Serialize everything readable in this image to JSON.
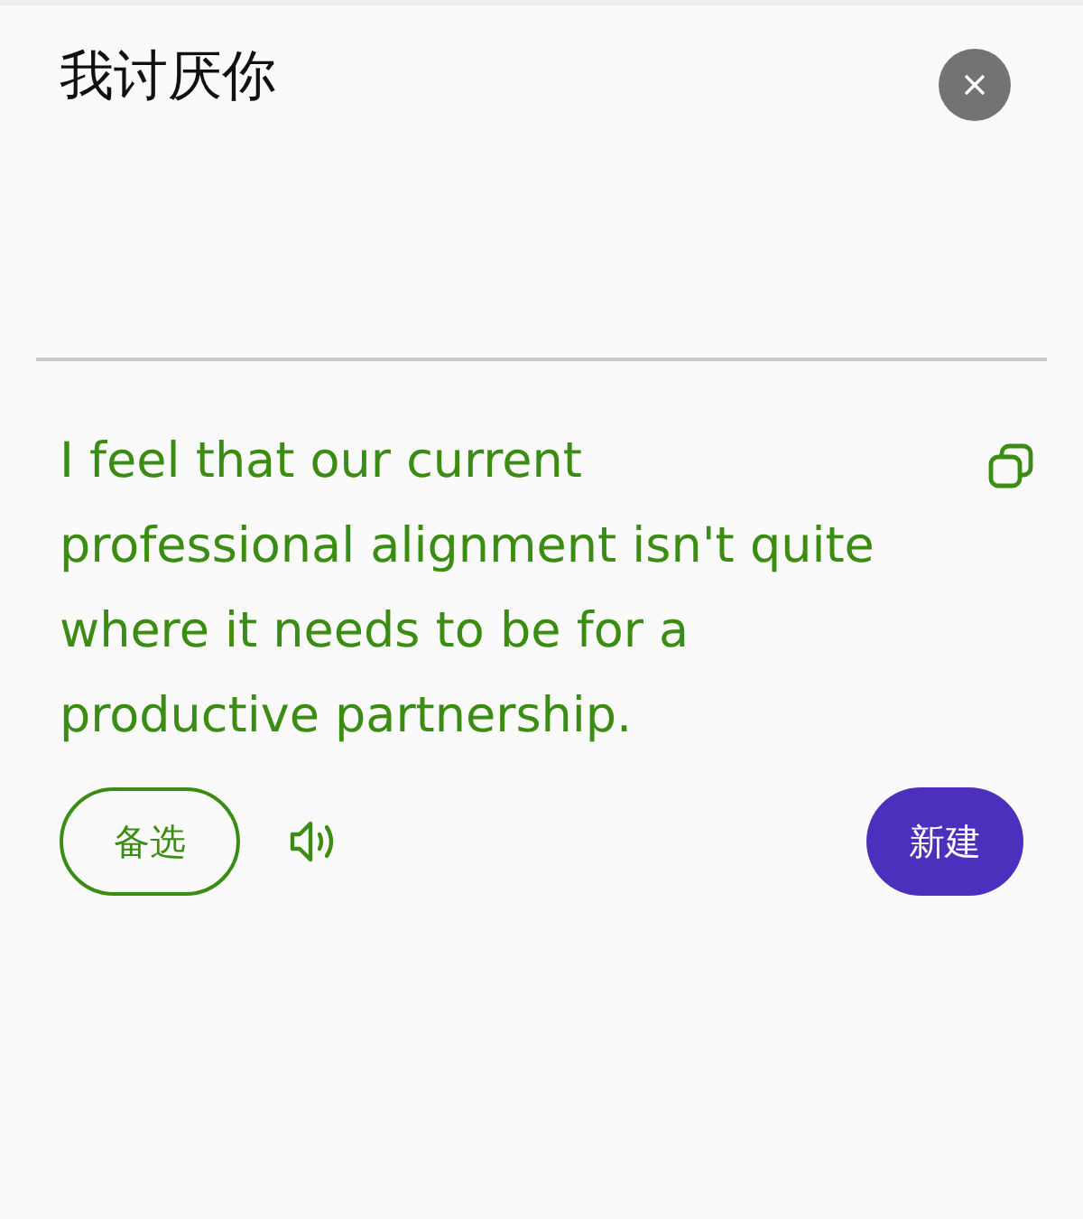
{
  "source": {
    "text": "我讨厌你"
  },
  "translation": {
    "text": "I feel that our current professional alignment isn't quite where it needs to be for a productive partnership."
  },
  "actions": {
    "alternatives": "备选",
    "new": "新建"
  }
}
